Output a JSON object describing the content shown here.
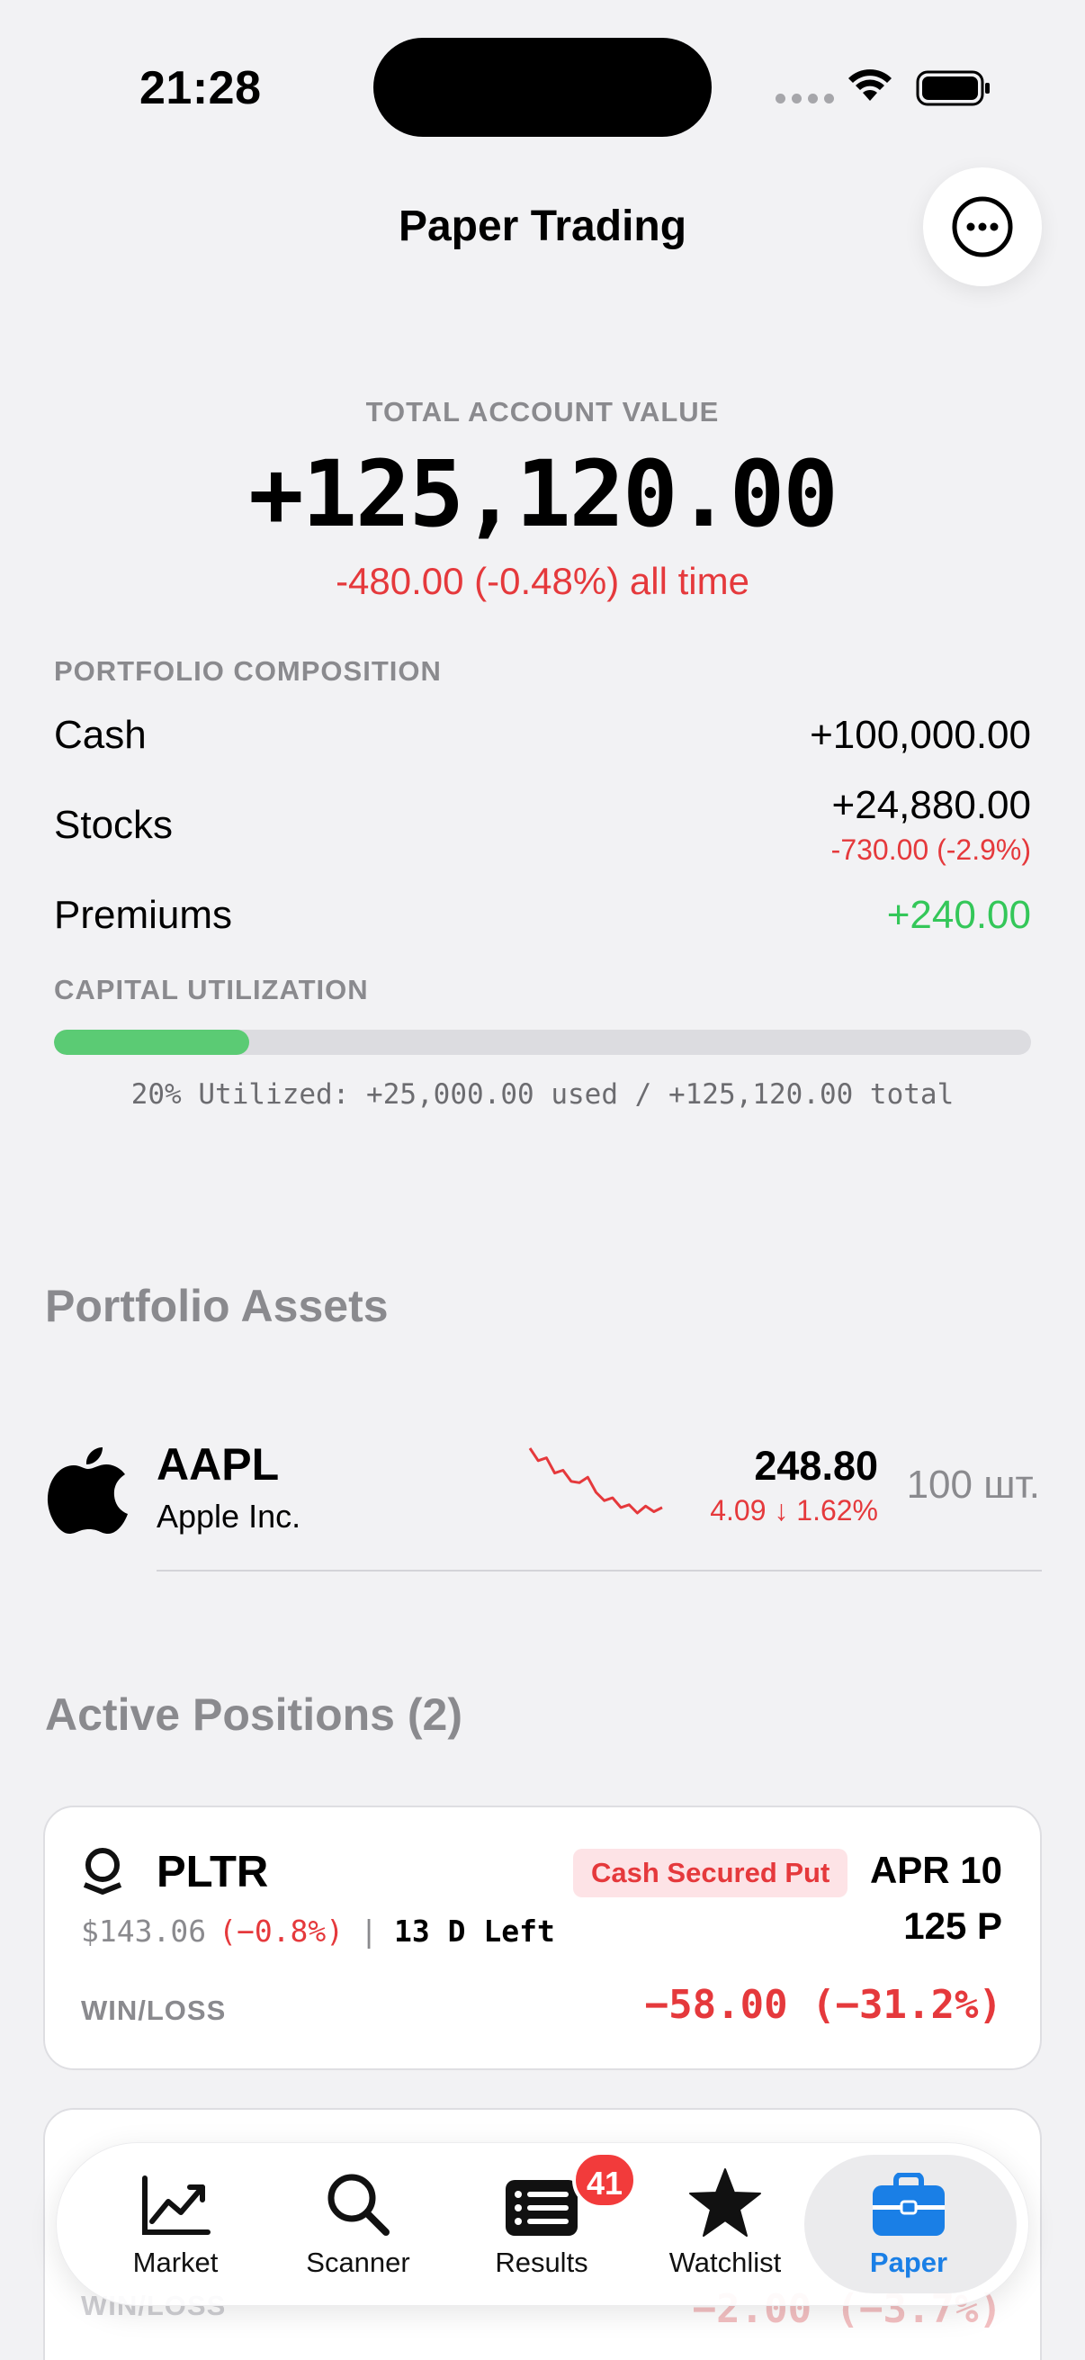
{
  "status_bar": {
    "time": "21:28"
  },
  "header": {
    "title": "Paper Trading",
    "more_icon": "ellipsis-circle-icon"
  },
  "summary": {
    "total_label": "TOTAL ACCOUNT VALUE",
    "total_value": "+125,120.00",
    "total_change": "-480.00 (-0.48%) all time",
    "composition_label": "PORTFOLIO COMPOSITION",
    "rows": [
      {
        "label": "Cash",
        "value": "+100,000.00"
      },
      {
        "label": "Stocks",
        "value": "+24,880.00",
        "sub": "-730.00 (-2.9%)"
      },
      {
        "label": "Premiums",
        "value": "+240.00"
      }
    ],
    "utilization_label": "CAPITAL UTILIZATION",
    "utilization_fraction": 0.2,
    "utilization_text": "20% Utilized: +25,000.00 used / +125,120.00 total"
  },
  "assets": {
    "title": "Portfolio Assets",
    "items": [
      {
        "ticker": "AAPL",
        "name": "Apple Inc.",
        "price": "248.80",
        "change": "4.09 ↓ 1.62%",
        "quantity": "100 шт.",
        "sparkline": [
          9.8,
          8.0,
          8.4,
          6.2,
          6.6,
          5.0,
          4.8,
          5.6,
          3.4,
          2.2,
          2.6,
          1.2,
          1.6,
          0.4,
          1.4,
          0.6,
          1.2
        ]
      }
    ]
  },
  "positions": {
    "title": "Active Positions (2)",
    "items": [
      {
        "ticker": "PLTR",
        "strategy": "Cash Secured Put",
        "expiry": "APR 10",
        "strike": "125 P",
        "underlying_price": "$143.06",
        "underlying_change": "(−0.8%)",
        "separator": "|",
        "days_left": "13 D Left",
        "winloss_label": "WIN/LOSS",
        "winloss_value": "−58.00 (−31.2%)"
      },
      {
        "winloss_label": "WIN/LOSS",
        "winloss_value": "−2.00 (−3.7%)"
      }
    ]
  },
  "tabbar": {
    "tabs": [
      {
        "label": "Market",
        "icon": "chart-line-icon"
      },
      {
        "label": "Scanner",
        "icon": "magnifier-icon"
      },
      {
        "label": "Results",
        "icon": "list-icon",
        "badge": "41"
      },
      {
        "label": "Watchlist",
        "icon": "star-icon"
      },
      {
        "label": "Paper",
        "icon": "briefcase-icon",
        "active": true
      }
    ]
  },
  "colors": {
    "negative": "#e5393c",
    "positive": "#34c759",
    "accent": "#1a7fe6",
    "badge_bg": "#fde3e6"
  }
}
